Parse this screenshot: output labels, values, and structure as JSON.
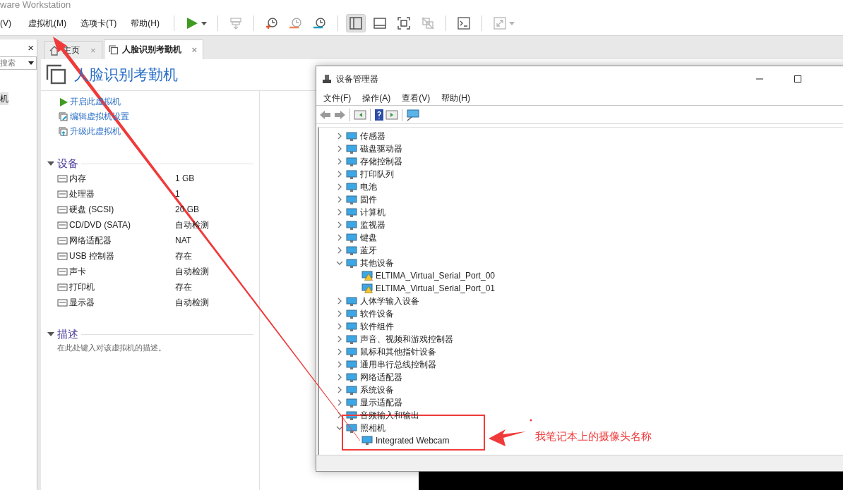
{
  "app": {
    "title": "ware Workstation",
    "menu": [
      "(V)",
      "虚拟机(M)",
      "选项卡(T)",
      "帮助(H)"
    ],
    "toolbar_groups": [
      [
        {
          "kind": "play",
          "disabled": false
        }
      ],
      [
        {
          "kind": "send-keys",
          "disabled": true
        }
      ],
      [
        {
          "kind": "snapshot-take",
          "disabled": false
        },
        {
          "kind": "snapshot-revert",
          "disabled": false
        },
        {
          "kind": "snapshot-manage",
          "disabled": false
        }
      ],
      [
        {
          "kind": "view-sidebar",
          "disabled": false,
          "selected": true
        },
        {
          "kind": "view-thumbnail",
          "disabled": false,
          "selected": false
        },
        {
          "kind": "view-fullscreen",
          "disabled": false,
          "selected": false
        },
        {
          "kind": "view-unity",
          "disabled": true,
          "selected": false
        }
      ],
      [
        {
          "kind": "terminal",
          "disabled": false
        }
      ],
      [
        {
          "kind": "stretch",
          "disabled": true
        }
      ]
    ]
  },
  "library": {
    "close": "×",
    "search": {
      "placeholder": "搜索"
    },
    "items": [
      {
        "label": "机",
        "selected": true
      }
    ]
  },
  "tabs": [
    {
      "label": "主页",
      "close": "×",
      "selected": false
    },
    {
      "label": "人脸识别考勤机",
      "close": "×",
      "selected": true
    }
  ],
  "vm": {
    "title": "人脸识别考勤机",
    "actions": [
      {
        "kind": "play",
        "label": "开启此虚拟机"
      },
      {
        "kind": "edit",
        "label": "编辑虚拟机设置"
      },
      {
        "kind": "upgrade",
        "label": "升级此虚拟机"
      }
    ],
    "devices_section": {
      "title": "设备",
      "expanded": true
    },
    "devices": [
      {
        "name": "内存",
        "value": "1 GB"
      },
      {
        "name": "处理器",
        "value": "1"
      },
      {
        "name": "硬盘 (SCSI)",
        "value": "20 GB"
      },
      {
        "name": "CD/DVD (SATA)",
        "value": "自动检测"
      },
      {
        "name": "网络适配器",
        "value": "NAT"
      },
      {
        "name": "USB 控制器",
        "value": "存在"
      },
      {
        "name": "声卡",
        "value": "自动检测"
      },
      {
        "name": "打印机",
        "value": "存在"
      },
      {
        "name": "显示器",
        "value": "自动检测"
      }
    ],
    "description": {
      "title": "描述",
      "expanded": true,
      "text": "在此处键入对该虚拟机的描述。"
    }
  },
  "device_manager": {
    "title": "设备管理器",
    "menu": [
      "文件(F)",
      "操作(A)",
      "查看(V)",
      "帮助(H)"
    ],
    "tree": [
      {
        "label": "传感器",
        "expanded": false
      },
      {
        "label": "磁盘驱动器",
        "expanded": false
      },
      {
        "label": "存储控制器",
        "expanded": false
      },
      {
        "label": "打印队列",
        "expanded": false
      },
      {
        "label": "电池",
        "expanded": false
      },
      {
        "label": "固件",
        "expanded": false
      },
      {
        "label": "计算机",
        "expanded": false
      },
      {
        "label": "监视器",
        "expanded": false
      },
      {
        "label": "键盘",
        "expanded": false
      },
      {
        "label": "蓝牙",
        "expanded": false
      },
      {
        "label": "其他设备",
        "expanded": true,
        "children": [
          {
            "label": "ELTIMA_Virtual_Serial_Port_00",
            "warning": true
          },
          {
            "label": "ELTIMA_Virtual_Serial_Port_01",
            "warning": true
          }
        ]
      },
      {
        "label": "人体学输入设备",
        "expanded": false
      },
      {
        "label": "软件设备",
        "expanded": false
      },
      {
        "label": "软件组件",
        "expanded": false
      },
      {
        "label": "声音、视频和游戏控制器",
        "expanded": false
      },
      {
        "label": "鼠标和其他指针设备",
        "expanded": false
      },
      {
        "label": "通用串行总线控制器",
        "expanded": false
      },
      {
        "label": "网络适配器",
        "expanded": false
      },
      {
        "label": "系统设备",
        "expanded": false
      },
      {
        "label": "显示适配器",
        "expanded": false
      },
      {
        "label": "音频输入和输出",
        "expanded": false
      },
      {
        "label": "照相机",
        "expanded": true,
        "children": [
          {
            "label": "Integrated Webcam",
            "warning": false
          }
        ]
      }
    ]
  },
  "annotation": {
    "text": "我笔记本上的摄像头名称"
  }
}
